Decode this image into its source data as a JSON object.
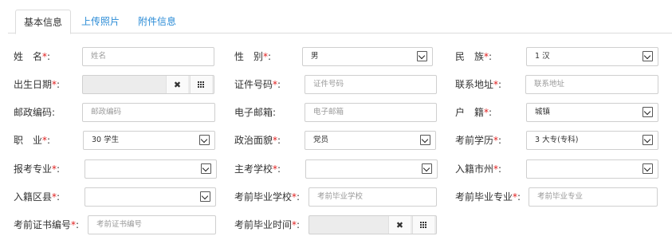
{
  "tabs": [
    "基本信息",
    "上传照片",
    "附件信息"
  ],
  "form": {
    "name": {
      "label": "姓　名",
      "required": "*",
      "colon": ":",
      "placeholder": "姓名"
    },
    "gender": {
      "label": "性　别",
      "required": "*",
      "colon": ":",
      "value": "男"
    },
    "ethnicity": {
      "label": "民　族",
      "required": "*",
      "colon": ":",
      "value": "1 汉"
    },
    "birthdate": {
      "label": "出生日期",
      "required": "*",
      "colon": ":",
      "value": ""
    },
    "id_number": {
      "label": "证件号码",
      "required": "*",
      "colon": ":",
      "placeholder": "证件号码"
    },
    "address": {
      "label": "联系地址",
      "required": "*",
      "colon": ":",
      "placeholder": "联系地址"
    },
    "postcode": {
      "label": "邮政编码",
      "colon": ":",
      "placeholder": "邮政编码"
    },
    "email": {
      "label": "电子邮箱",
      "colon": ":",
      "placeholder": "电子邮箱"
    },
    "household": {
      "label": "户　籍",
      "required": "*",
      "colon": ":",
      "value": "城镇"
    },
    "occupation": {
      "label": "职　业",
      "required": "*",
      "colon": ":",
      "value": "30 学生"
    },
    "political": {
      "label": "政治面貌",
      "required": "*",
      "colon": ":",
      "value": "党员"
    },
    "education": {
      "label": "考前学历",
      "required": "*",
      "colon": ":",
      "value": "3 大专(专科)"
    },
    "major_applied": {
      "label": "报考专业",
      "required": "*",
      "colon": ":",
      "value": ""
    },
    "main_school": {
      "label": "主考学校",
      "required": "*",
      "colon": ":",
      "value": ""
    },
    "city": {
      "label": "入籍市州",
      "required": "*",
      "colon": ":",
      "value": ""
    },
    "district": {
      "label": "入籍区县",
      "required": "*",
      "colon": ":",
      "value": ""
    },
    "prev_school": {
      "label": "考前毕业学校",
      "required": "*",
      "colon": ":",
      "placeholder": "考前毕业学校"
    },
    "prev_major": {
      "label": "考前毕业专业",
      "required": "*",
      "colon": ":",
      "placeholder": "考前毕业专业"
    },
    "cert_number": {
      "label": "考前证书编号",
      "required": "*",
      "colon": ":",
      "placeholder": "考前证书编号"
    },
    "grad_time": {
      "label": "考前毕业时间",
      "required": "*",
      "colon": ":",
      "value": ""
    }
  },
  "icons": {
    "clear": "close-icon",
    "calendar": "calendar-grid-icon",
    "dropdown": "chevron-down-icon"
  },
  "colors": {
    "link": "#2a8bd6",
    "required": "#e02020",
    "disabled_bg": "#ececec"
  }
}
